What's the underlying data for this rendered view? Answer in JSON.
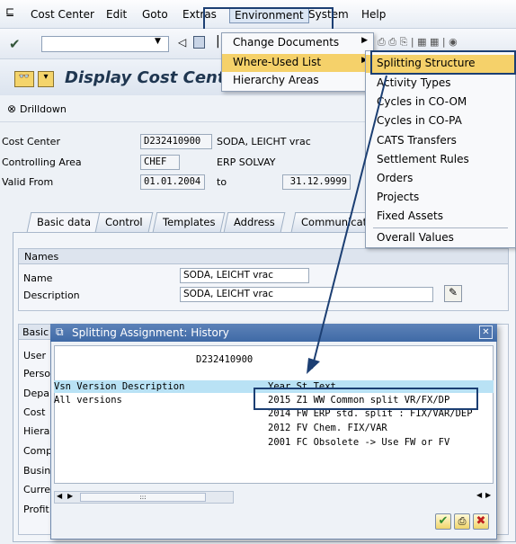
{
  "menubar": {
    "items": [
      {
        "label": "Cost Center",
        "u": "C"
      },
      {
        "label": "Edit",
        "u": "E"
      },
      {
        "label": "Goto",
        "u": "G"
      },
      {
        "label": "Extras",
        "u": ""
      },
      {
        "label": "Environment",
        "u": ""
      },
      {
        "label": "System",
        "u": ""
      },
      {
        "label": "Help",
        "u": "H"
      }
    ]
  },
  "title": "Display Cost Center: I",
  "app_toolbar": {
    "drilldown_label": "Drilldown"
  },
  "header_fields": {
    "cost_center_label": "Cost Center",
    "cost_center_value": "D232410900",
    "cost_center_desc": "SODA, LEICHT  vrac",
    "controlling_area_label": "Controlling Area",
    "controlling_area_value": "CHEF",
    "controlling_area_desc": "ERP SOLVAY",
    "valid_from_label": "Valid From",
    "valid_from_value": "01.01.2004",
    "to_label": "to",
    "valid_to_value": "31.12.9999"
  },
  "tabs": [
    "Basic data",
    "Control",
    "Templates",
    "Address",
    "Communication"
  ],
  "names_group": {
    "header": "Names",
    "name_label": "Name",
    "name_value": "SODA, LEICHT  vrac",
    "description_label": "Description",
    "description_value": "SODA, LEICHT  vrac"
  },
  "basic_group": {
    "header": "Basic",
    "truncated_labels": [
      "User",
      "Perso",
      "Depa",
      "Cost",
      "Hierar",
      "Comp",
      "Busin",
      "Curre",
      "Profit"
    ]
  },
  "environment_menu": {
    "items": [
      "Change Documents",
      "Where-Used List",
      "Hierarchy Areas"
    ]
  },
  "where_used_submenu": {
    "items": [
      "Splitting Structure",
      "Activity Types",
      "Cycles in CO-OM",
      "Cycles in CO-PA",
      "CATS Transfers",
      "Settlement Rules",
      "Orders",
      "Projects",
      "Fixed Assets",
      "Overall Values"
    ]
  },
  "popup": {
    "title": "Splitting Assignment: History",
    "cost_center": "D232410900",
    "header_left": "Vsn Version Description",
    "header_right": "Year St Text",
    "left_rows": [
      "All versions"
    ],
    "rows": [
      "2015 Z1 WW Common split VR/FX/DP",
      "2014 FW ERP std. split : FIX/VAR/DEP",
      "2012 FV Chem. FIX/VAR",
      "2001 FC Obsolete -> Use FW or FV"
    ],
    "scroll_dots": ":::"
  },
  "colors": {
    "highlight_box": "#1c3f73",
    "popup_title": "#4a72ad",
    "selected_row": "#b9e2f5",
    "menu_highlight": "#f5d16a"
  }
}
